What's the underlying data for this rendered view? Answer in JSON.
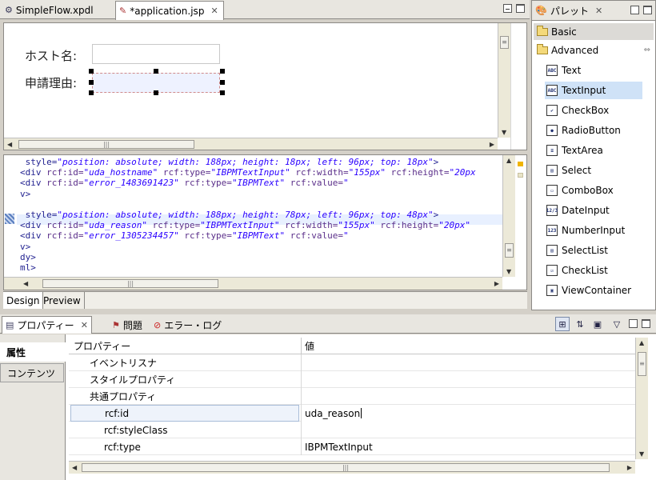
{
  "editor": {
    "tabs": [
      {
        "label": "SimpleFlow.xpdl",
        "icon": "flow-file-icon"
      },
      {
        "label": "*application.jsp",
        "icon": "jsp-file-icon"
      }
    ]
  },
  "design": {
    "fields": [
      {
        "label": "ホスト名:"
      },
      {
        "label": "申請理由:"
      }
    ]
  },
  "source": {
    "lines": [
      {
        "parts": [
          [
            "tag",
            " style="
          ],
          [
            "val",
            "\"position: absolute; width: 188px; height: 18px; left: 96px; top: 18px\""
          ],
          [
            "tag",
            ">"
          ]
        ]
      },
      {
        "parts": [
          [
            "tag",
            "<div "
          ],
          [
            "attr",
            "rcf:id="
          ],
          [
            "val",
            "\"uda_hostname\""
          ],
          [
            "attr",
            " rcf:type="
          ],
          [
            "val",
            "\"IBPMTextInput\""
          ],
          [
            "attr",
            " rcf:width="
          ],
          [
            "val",
            "\"155px\""
          ],
          [
            "attr",
            " rcf:height="
          ],
          [
            "val",
            "\"20px"
          ]
        ]
      },
      {
        "parts": [
          [
            "tag",
            "<div "
          ],
          [
            "attr",
            "rcf:id="
          ],
          [
            "val",
            "\"error_1483691423\""
          ],
          [
            "attr",
            " rcf:type="
          ],
          [
            "val",
            "\"IBPMText\""
          ],
          [
            "attr",
            " rcf:value="
          ],
          [
            "val",
            "\""
          ]
        ]
      },
      {
        "parts": [
          [
            "tag",
            "v>"
          ]
        ]
      },
      {
        "parts": [
          [
            "tag",
            ""
          ]
        ]
      },
      {
        "parts": [
          [
            "tag",
            " style="
          ],
          [
            "val",
            "\"position: absolute; width: 188px; height: 78px; left: 96px; top: 48px\""
          ],
          [
            "tag",
            ">"
          ]
        ]
      },
      {
        "parts": [
          [
            "tag",
            "<div "
          ],
          [
            "attr",
            "rcf:id="
          ],
          [
            "val",
            "\"uda_reason\""
          ],
          [
            "attr",
            " rcf:type="
          ],
          [
            "val",
            "\"IBPMTextInput\""
          ],
          [
            "attr",
            " rcf:width="
          ],
          [
            "val",
            "\"155px\""
          ],
          [
            "attr",
            " rcf:height="
          ],
          [
            "val",
            "\"20px\""
          ]
        ]
      },
      {
        "parts": [
          [
            "tag",
            "<div "
          ],
          [
            "attr",
            "rcf:id="
          ],
          [
            "val",
            "\"error_1305234457\""
          ],
          [
            "attr",
            " rcf:type="
          ],
          [
            "val",
            "\"IBPMText\""
          ],
          [
            "attr",
            " rcf:value="
          ],
          [
            "val",
            "\""
          ]
        ]
      },
      {
        "parts": [
          [
            "tag",
            "v>"
          ]
        ]
      },
      {
        "parts": [
          [
            "tag",
            "dy>"
          ]
        ]
      },
      {
        "parts": [
          [
            "tag",
            "ml>"
          ]
        ]
      }
    ]
  },
  "design_tabs": [
    {
      "label": "Design"
    },
    {
      "label": "Preview"
    }
  ],
  "palette": {
    "title": "パレット",
    "groups": [
      {
        "label": "Basic"
      },
      {
        "label": "Advanced"
      }
    ],
    "items": [
      {
        "label": "Text",
        "glyph": "ABC"
      },
      {
        "label": "TextInput",
        "glyph": "ABC"
      },
      {
        "label": "CheckBox",
        "glyph": "✔"
      },
      {
        "label": "RadioButton",
        "glyph": "●"
      },
      {
        "label": "TextArea",
        "glyph": "≡"
      },
      {
        "label": "Select",
        "glyph": "▤"
      },
      {
        "label": "ComboBox",
        "glyph": "▭"
      },
      {
        "label": "DateInput",
        "glyph": "12/3"
      },
      {
        "label": "NumberInput",
        "glyph": "123"
      },
      {
        "label": "SelectList",
        "glyph": "▤"
      },
      {
        "label": "CheckList",
        "glyph": "☑"
      },
      {
        "label": "ViewContainer",
        "glyph": "▣"
      }
    ],
    "selected_item": "TextInput"
  },
  "properties_view": {
    "tabs": [
      {
        "label": "プロパティー",
        "icon": "properties-icon"
      },
      {
        "label": "問題",
        "icon": "problems-icon"
      },
      {
        "label": "エラー・ログ",
        "icon": "error-log-icon"
      }
    ],
    "side_tabs": [
      {
        "label": "属性"
      },
      {
        "label": "コンテンツ"
      }
    ],
    "columns": {
      "name": "プロパティー",
      "value": "値"
    },
    "rows": [
      {
        "name": "イベントリスナ",
        "value": "",
        "indent": 1
      },
      {
        "name": "スタイルプロパティ",
        "value": "",
        "indent": 1
      },
      {
        "name": "共通プロパティ",
        "value": "",
        "indent": 1
      },
      {
        "name": "rcf:id",
        "value": "uda_reason",
        "indent": 2
      },
      {
        "name": "rcf:styleClass",
        "value": "",
        "indent": 2
      },
      {
        "name": "rcf:type",
        "value": "IBPMTextInput",
        "indent": 2
      }
    ]
  },
  "colors": {
    "selection": "#cfe2f7",
    "code_value": "#2a00ff",
    "code_tag": "#1f1f8f",
    "code_attr": "#5b2f8a"
  }
}
